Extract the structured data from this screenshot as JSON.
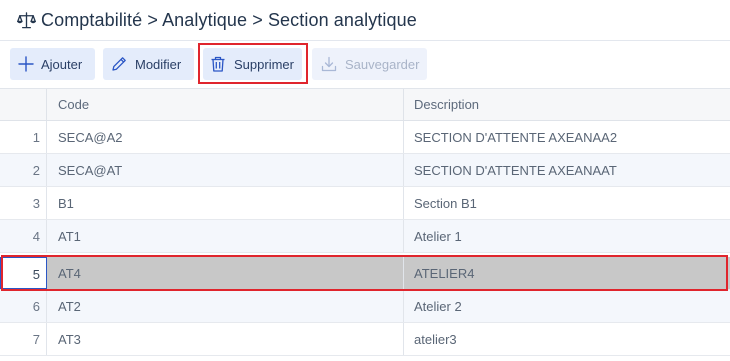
{
  "header": {
    "breadcrumb": "Comptabilité > Analytique > Section analytique",
    "icon": "balance-scale-icon"
  },
  "toolbar": {
    "add_label": "Ajouter",
    "edit_label": "Modifier",
    "delete_label": "Supprimer",
    "save_label": "Sauvegarder",
    "highlight_color": "#e0252d"
  },
  "grid": {
    "columns": {
      "code": "Code",
      "description": "Description"
    },
    "selected_row": 5,
    "rows": [
      {
        "index": "1",
        "code": "SECA@A2",
        "description": "SECTION D'ATTENTE AXEANAA2"
      },
      {
        "index": "2",
        "code": "SECA@AT",
        "description": "SECTION D'ATTENTE AXEANAAT"
      },
      {
        "index": "3",
        "code": "B1",
        "description": "Section B1"
      },
      {
        "index": "4",
        "code": "AT1",
        "description": "Atelier 1"
      },
      {
        "index": "5",
        "code": "AT4",
        "description": "ATELIER4"
      },
      {
        "index": "6",
        "code": "AT2",
        "description": "Atelier 2"
      },
      {
        "index": "7",
        "code": "AT3",
        "description": "atelier3"
      }
    ]
  },
  "colors": {
    "accent": "#2b56c5",
    "button_bg": "#e4ecfb",
    "selected_row_bg": "#c8c8c8",
    "highlight": "#e0252d"
  }
}
